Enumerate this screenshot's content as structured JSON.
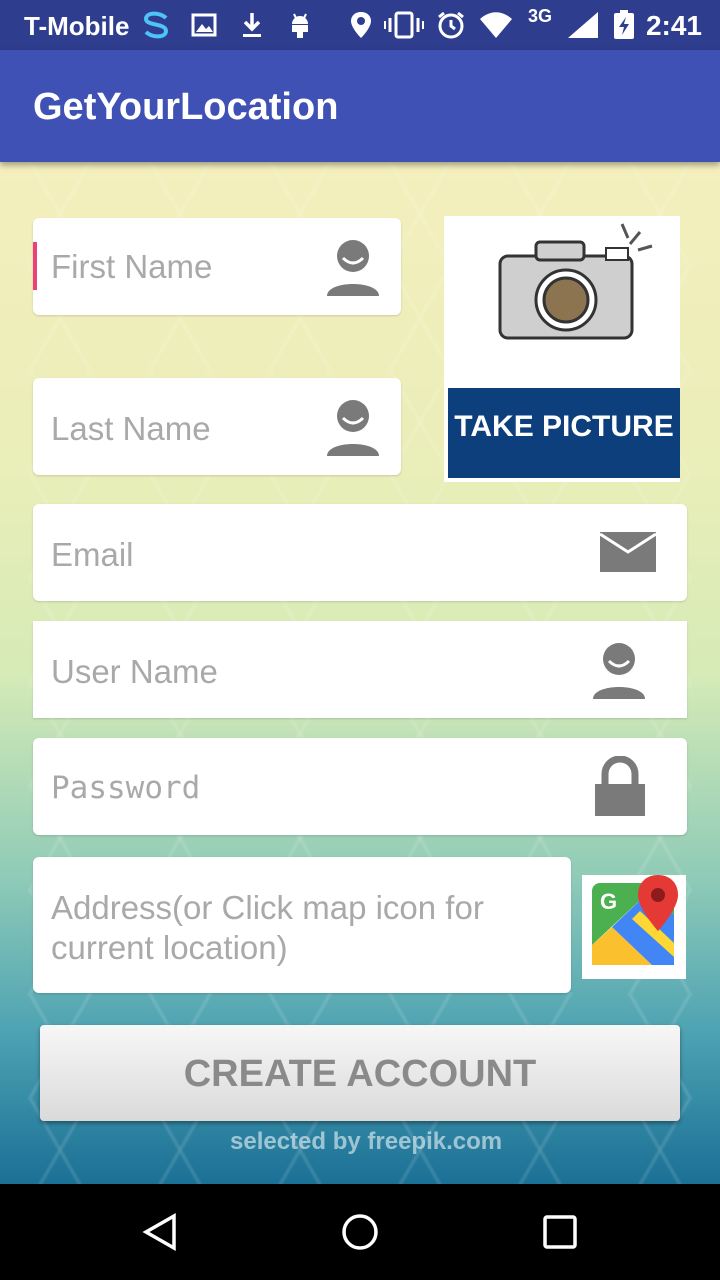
{
  "status_bar": {
    "carrier": "T-Mobile",
    "network": "3G",
    "time": "2:41",
    "icons": [
      "s-app-icon",
      "image-icon",
      "download-icon",
      "android-icon",
      "location-icon",
      "vibrate-icon",
      "alarm-icon",
      "wifi-icon",
      "signal-icon",
      "battery-charging-icon"
    ]
  },
  "app_bar": {
    "title": "GetYourLocation",
    "color": "#3f51b5"
  },
  "form": {
    "first_name": {
      "placeholder": "First Name",
      "icon": "person-icon"
    },
    "last_name": {
      "placeholder": "Last Name",
      "icon": "person-icon"
    },
    "email": {
      "placeholder": "Email",
      "icon": "envelope-icon"
    },
    "user_name": {
      "placeholder": "User Name",
      "icon": "person-icon"
    },
    "password": {
      "placeholder": "Password",
      "icon": "lock-icon"
    },
    "address": {
      "placeholder_line1": "Address(or Click map icon for",
      "placeholder_line2": "current location)"
    }
  },
  "take_picture": {
    "label": "TAKE PICTURE",
    "icon": "camera-icon",
    "banner_color": "#0d3f7c"
  },
  "map_button": {
    "icon": "google-maps-icon"
  },
  "create_button": {
    "label": "CREATE ACCOUNT"
  },
  "watermark": {
    "text": "selected by  freepik.com"
  },
  "nav_bar": {
    "back": "back-icon",
    "home": "home-icon",
    "recents": "recents-icon"
  }
}
